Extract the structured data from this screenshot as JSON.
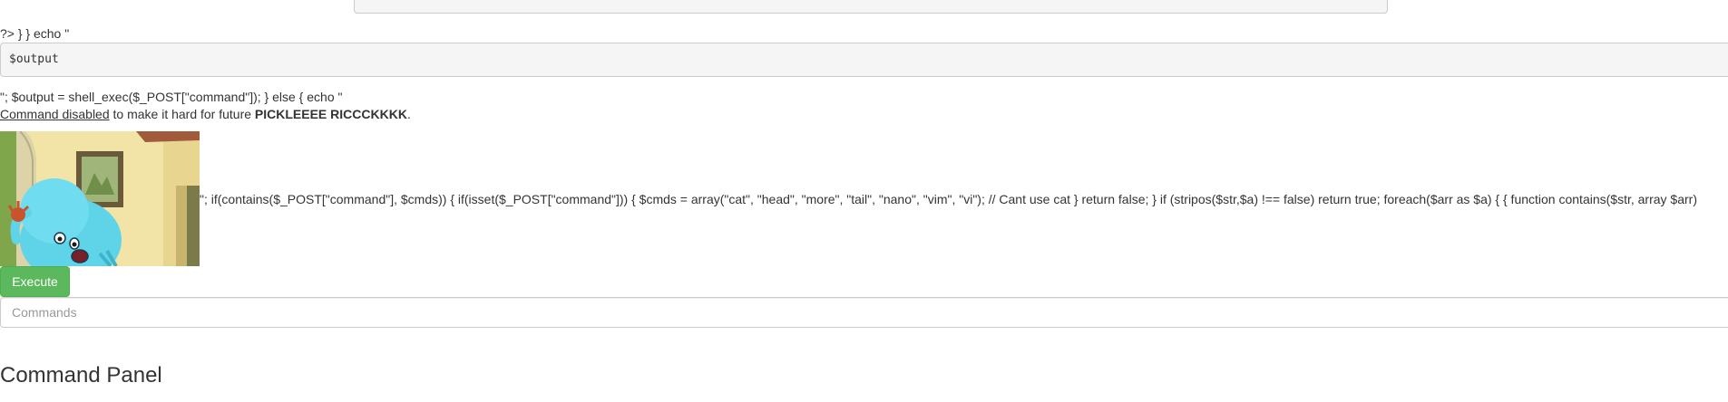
{
  "echo_open_text": "?> } } echo \"",
  "output_box": "$output",
  "shell_exec_text": "\"; $output = shell_exec($_POST[\"command\"]); } else { echo \"",
  "disabled_notice": {
    "link": "Command disabled",
    "middle": " to make it hard for future ",
    "bold": "PICKLEEEE RICCCKKKK",
    "end": "."
  },
  "image_alt": "Mr. Meeseeks",
  "code_line": "\"; if(contains($_POST[\"command\"], $cmds)) { if(isset($_POST[\"command\"])) { $cmds = array(\"cat\", \"head\", \"more\", \"tail\", \"nano\", \"vim\", \"vi\"); // Cant use cat } return false; } if (stripos($str,$a) !== false) return true; foreach($arr as $a) { { function contains($str, array $arr)",
  "execute_button_label": "Execute",
  "commands_input": {
    "value": "",
    "placeholder": "Commands"
  },
  "panel_title": "Command Panel",
  "colors": {
    "button_green": "#5cb85c",
    "pre_background": "#f5f5f5",
    "text": "#333333"
  }
}
